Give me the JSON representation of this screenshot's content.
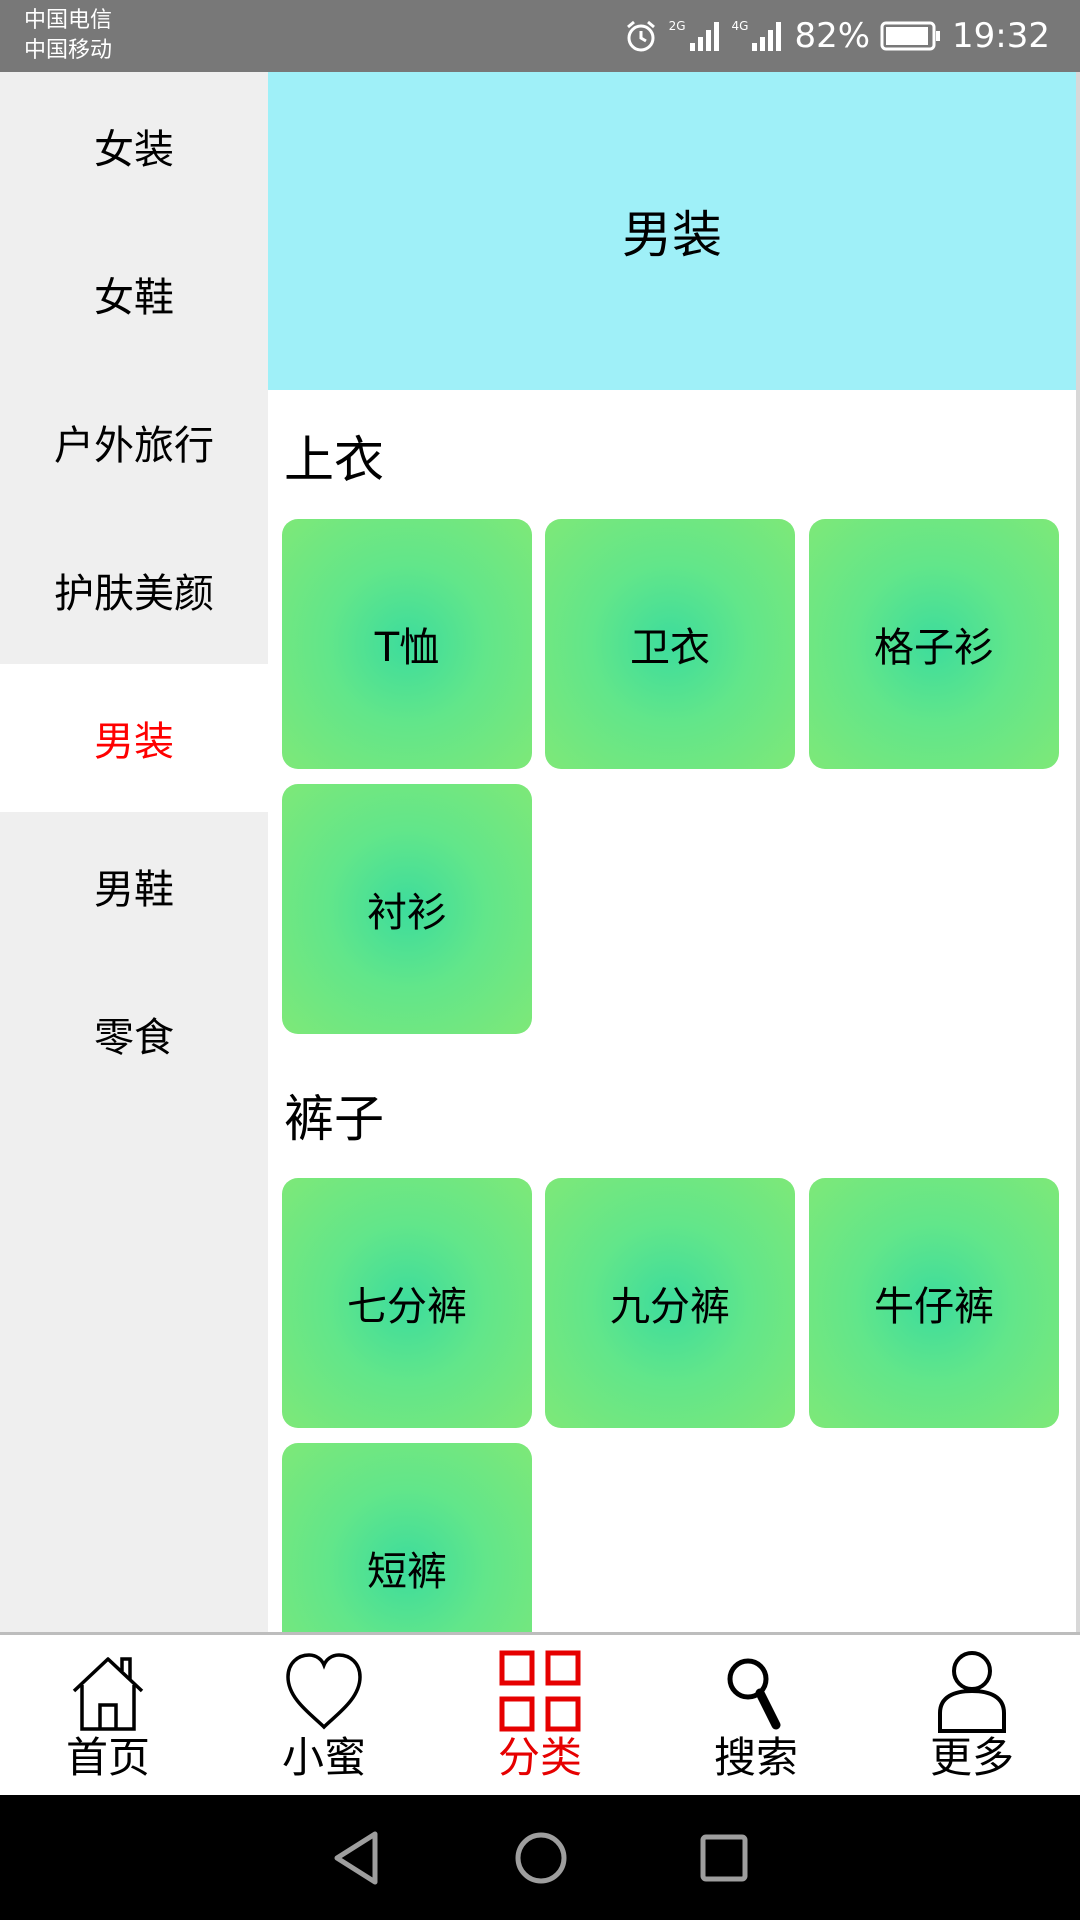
{
  "status_bar": {
    "carrier_1": "中国电信",
    "carrier_2": "中国移动",
    "network_1": "2G",
    "network_2": "4G",
    "battery": "82%",
    "time": "19:32"
  },
  "sidebar": {
    "items": [
      {
        "label": "女装"
      },
      {
        "label": "女鞋"
      },
      {
        "label": "户外旅行"
      },
      {
        "label": "护肤美颜"
      },
      {
        "label": "男装",
        "active": true
      },
      {
        "label": "男鞋"
      },
      {
        "label": "零食"
      }
    ],
    "active_color": "#ff0000"
  },
  "content": {
    "banner_title": "男装",
    "banner_color": "#9ff0f8",
    "sections": [
      {
        "title": "上衣",
        "items": [
          "T恤",
          "卫衣",
          "格子衫",
          "衬衫"
        ]
      },
      {
        "title": "裤子",
        "items": [
          "七分裤",
          "九分裤",
          "牛仔裤",
          "短裤"
        ]
      }
    ]
  },
  "tabbar": {
    "tabs": [
      {
        "label": "首页",
        "icon": "home-icon"
      },
      {
        "label": "小蜜",
        "icon": "heart-icon"
      },
      {
        "label": "分类",
        "icon": "grid-icon",
        "active": true
      },
      {
        "label": "搜索",
        "icon": "search-icon"
      },
      {
        "label": "更多",
        "icon": "user-icon"
      }
    ],
    "active_color": "#e60000"
  },
  "navbar": {
    "buttons": [
      "back-icon",
      "home-circle-icon",
      "recents-icon"
    ]
  }
}
